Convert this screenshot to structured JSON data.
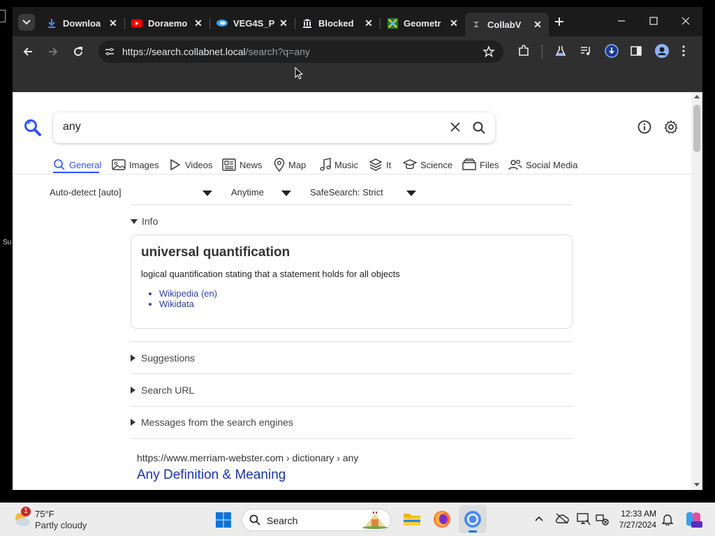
{
  "browser": {
    "tabs": [
      {
        "title": "Downloa",
        "icon": "download-icon"
      },
      {
        "title": "Doraemo",
        "icon": "youtube-icon"
      },
      {
        "title": "VEG4S_P",
        "icon": "site-icon"
      },
      {
        "title": "Blocked",
        "icon": "blocked-icon"
      },
      {
        "title": "Geometr",
        "icon": "geometry-icon"
      },
      {
        "title": "CollabV",
        "icon": "collab-icon"
      }
    ],
    "url_host": "https://search.collabnet.local",
    "url_path": "/search?q=any"
  },
  "search": {
    "query": "any",
    "categories": [
      {
        "label": "General",
        "icon": "search-icon"
      },
      {
        "label": "Images",
        "icon": "image-icon"
      },
      {
        "label": "Videos",
        "icon": "play-icon"
      },
      {
        "label": "News",
        "icon": "newspaper-icon"
      },
      {
        "label": "Map",
        "icon": "map-pin-icon"
      },
      {
        "label": "Music",
        "icon": "music-icon"
      },
      {
        "label": "It",
        "icon": "layers-icon"
      },
      {
        "label": "Science",
        "icon": "science-icon"
      },
      {
        "label": "Files",
        "icon": "files-icon"
      },
      {
        "label": "Social Media",
        "icon": "people-icon"
      }
    ],
    "filters": {
      "language": "Auto-detect [auto]",
      "time": "Anytime",
      "safesearch": "SafeSearch: Strict"
    },
    "info": {
      "label": "Info",
      "title": "universal quantification",
      "description": "logical quantification stating that a statement holds for all objects",
      "links": [
        "Wikipedia (en)",
        "Wikidata"
      ]
    },
    "sections": [
      "Suggestions",
      "Search URL",
      "Messages from the search engines"
    ],
    "result": {
      "url": "https://www.merriam-webster.com",
      "breadcrumb": "› dictionary › any",
      "title": "Any Definition & Meaning"
    }
  },
  "taskbar": {
    "weather_temp": "75°F",
    "weather_desc": "Partly cloudy",
    "weather_badge": "1",
    "search_label": "Search",
    "time": "12:33 AM",
    "date": "7/27/2024"
  },
  "desktop_peek": "Su"
}
